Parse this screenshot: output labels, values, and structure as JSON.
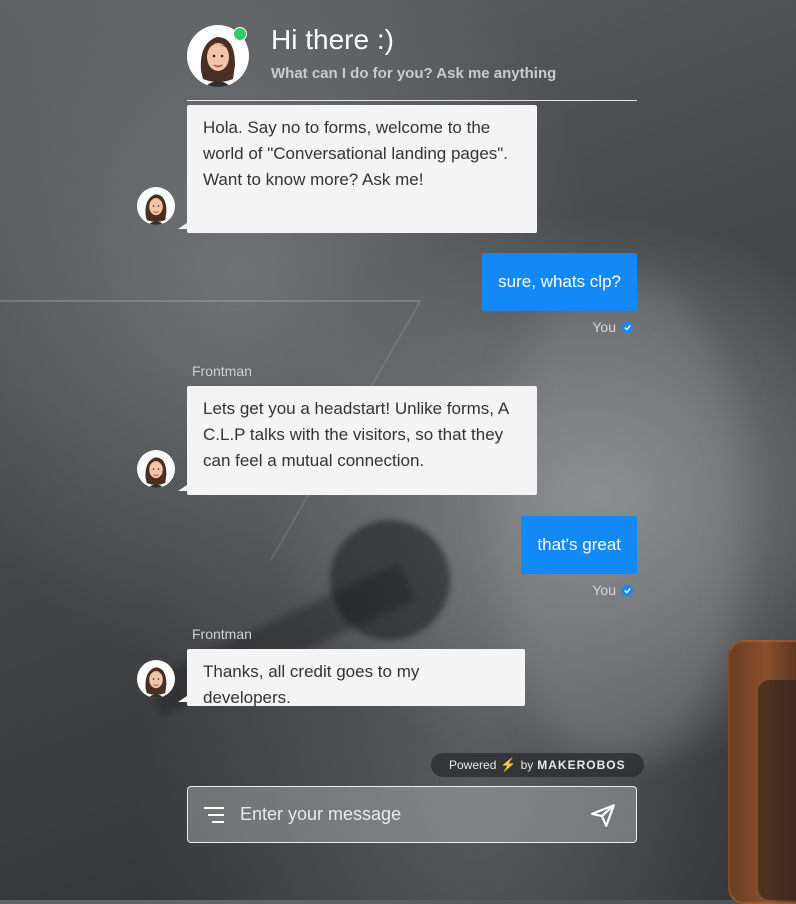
{
  "header": {
    "title": "Hi there :)",
    "subtitle": "What can I do for you? Ask me anything"
  },
  "messages": [
    {
      "from": "bot",
      "text": "Hola. Say no to forms, welcome to the world of \"Conversational landing pages\". Want to know more? Ask me!"
    },
    {
      "from": "user",
      "text": "sure, whats clp?",
      "label": "You"
    },
    {
      "from": "bot",
      "sender": "Frontman",
      "text": "Lets get you a headstart! Unlike forms, A C.L.P talks with the visitors, so that they can feel a mutual connection."
    },
    {
      "from": "user",
      "text": "that's great",
      "label": "You"
    },
    {
      "from": "bot",
      "sender": "Frontman",
      "text": "Thanks, all credit goes to my developers."
    }
  ],
  "footer": {
    "powered_label": "Powered",
    "by_label": "by",
    "brand": "MAKEROBOS"
  },
  "composer": {
    "placeholder": "Enter your message",
    "value": ""
  },
  "colors": {
    "accent": "#1389f7",
    "online": "#2ecc71",
    "bubble_bot": "#f4f4f4"
  },
  "icons": [
    "avatar",
    "online-dot",
    "check-icon",
    "bolt-icon",
    "menu-icon",
    "send-icon"
  ]
}
